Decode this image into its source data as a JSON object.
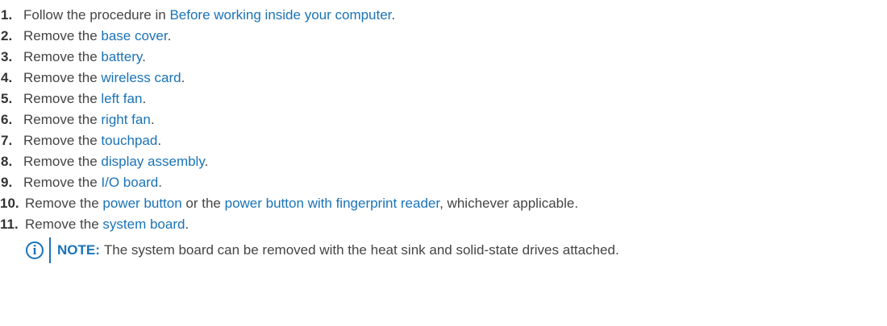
{
  "steps": [
    {
      "number": "1.",
      "parts": [
        {
          "text": "Follow the procedure in "
        },
        {
          "link": "Before working inside your computer"
        },
        {
          "text": "."
        }
      ]
    },
    {
      "number": "2.",
      "parts": [
        {
          "text": "Remove the "
        },
        {
          "link": "base cover"
        },
        {
          "text": "."
        }
      ]
    },
    {
      "number": "3.",
      "parts": [
        {
          "text": "Remove the "
        },
        {
          "link": "battery"
        },
        {
          "text": "."
        }
      ]
    },
    {
      "number": "4.",
      "parts": [
        {
          "text": "Remove the "
        },
        {
          "link": "wireless card"
        },
        {
          "text": "."
        }
      ]
    },
    {
      "number": "5.",
      "parts": [
        {
          "text": "Remove the "
        },
        {
          "link": "left fan"
        },
        {
          "text": "."
        }
      ]
    },
    {
      "number": "6.",
      "parts": [
        {
          "text": "Remove the "
        },
        {
          "link": "right fan"
        },
        {
          "text": "."
        }
      ]
    },
    {
      "number": "7.",
      "parts": [
        {
          "text": "Remove the "
        },
        {
          "link": "touchpad"
        },
        {
          "text": "."
        }
      ]
    },
    {
      "number": "8.",
      "parts": [
        {
          "text": "Remove the "
        },
        {
          "link": "display assembly"
        },
        {
          "text": "."
        }
      ]
    },
    {
      "number": "9.",
      "parts": [
        {
          "text": "Remove the "
        },
        {
          "link": "I/O board"
        },
        {
          "text": "."
        }
      ]
    },
    {
      "number": "10.",
      "parts": [
        {
          "text": "Remove the "
        },
        {
          "link": "power button"
        },
        {
          "text": " or the "
        },
        {
          "link": "power button with fingerprint reader"
        },
        {
          "text": ", whichever applicable."
        }
      ]
    },
    {
      "number": "11.",
      "parts": [
        {
          "text": "Remove the "
        },
        {
          "link": "system board"
        },
        {
          "text": "."
        }
      ]
    }
  ],
  "note": {
    "icon": "info-icon",
    "icon_glyph": "i",
    "label": "NOTE:",
    "text": "The system board can be removed with the heat sink and solid-state drives attached."
  },
  "colors": {
    "link": "#1a73b8",
    "text": "#444444",
    "number": "#333333"
  }
}
